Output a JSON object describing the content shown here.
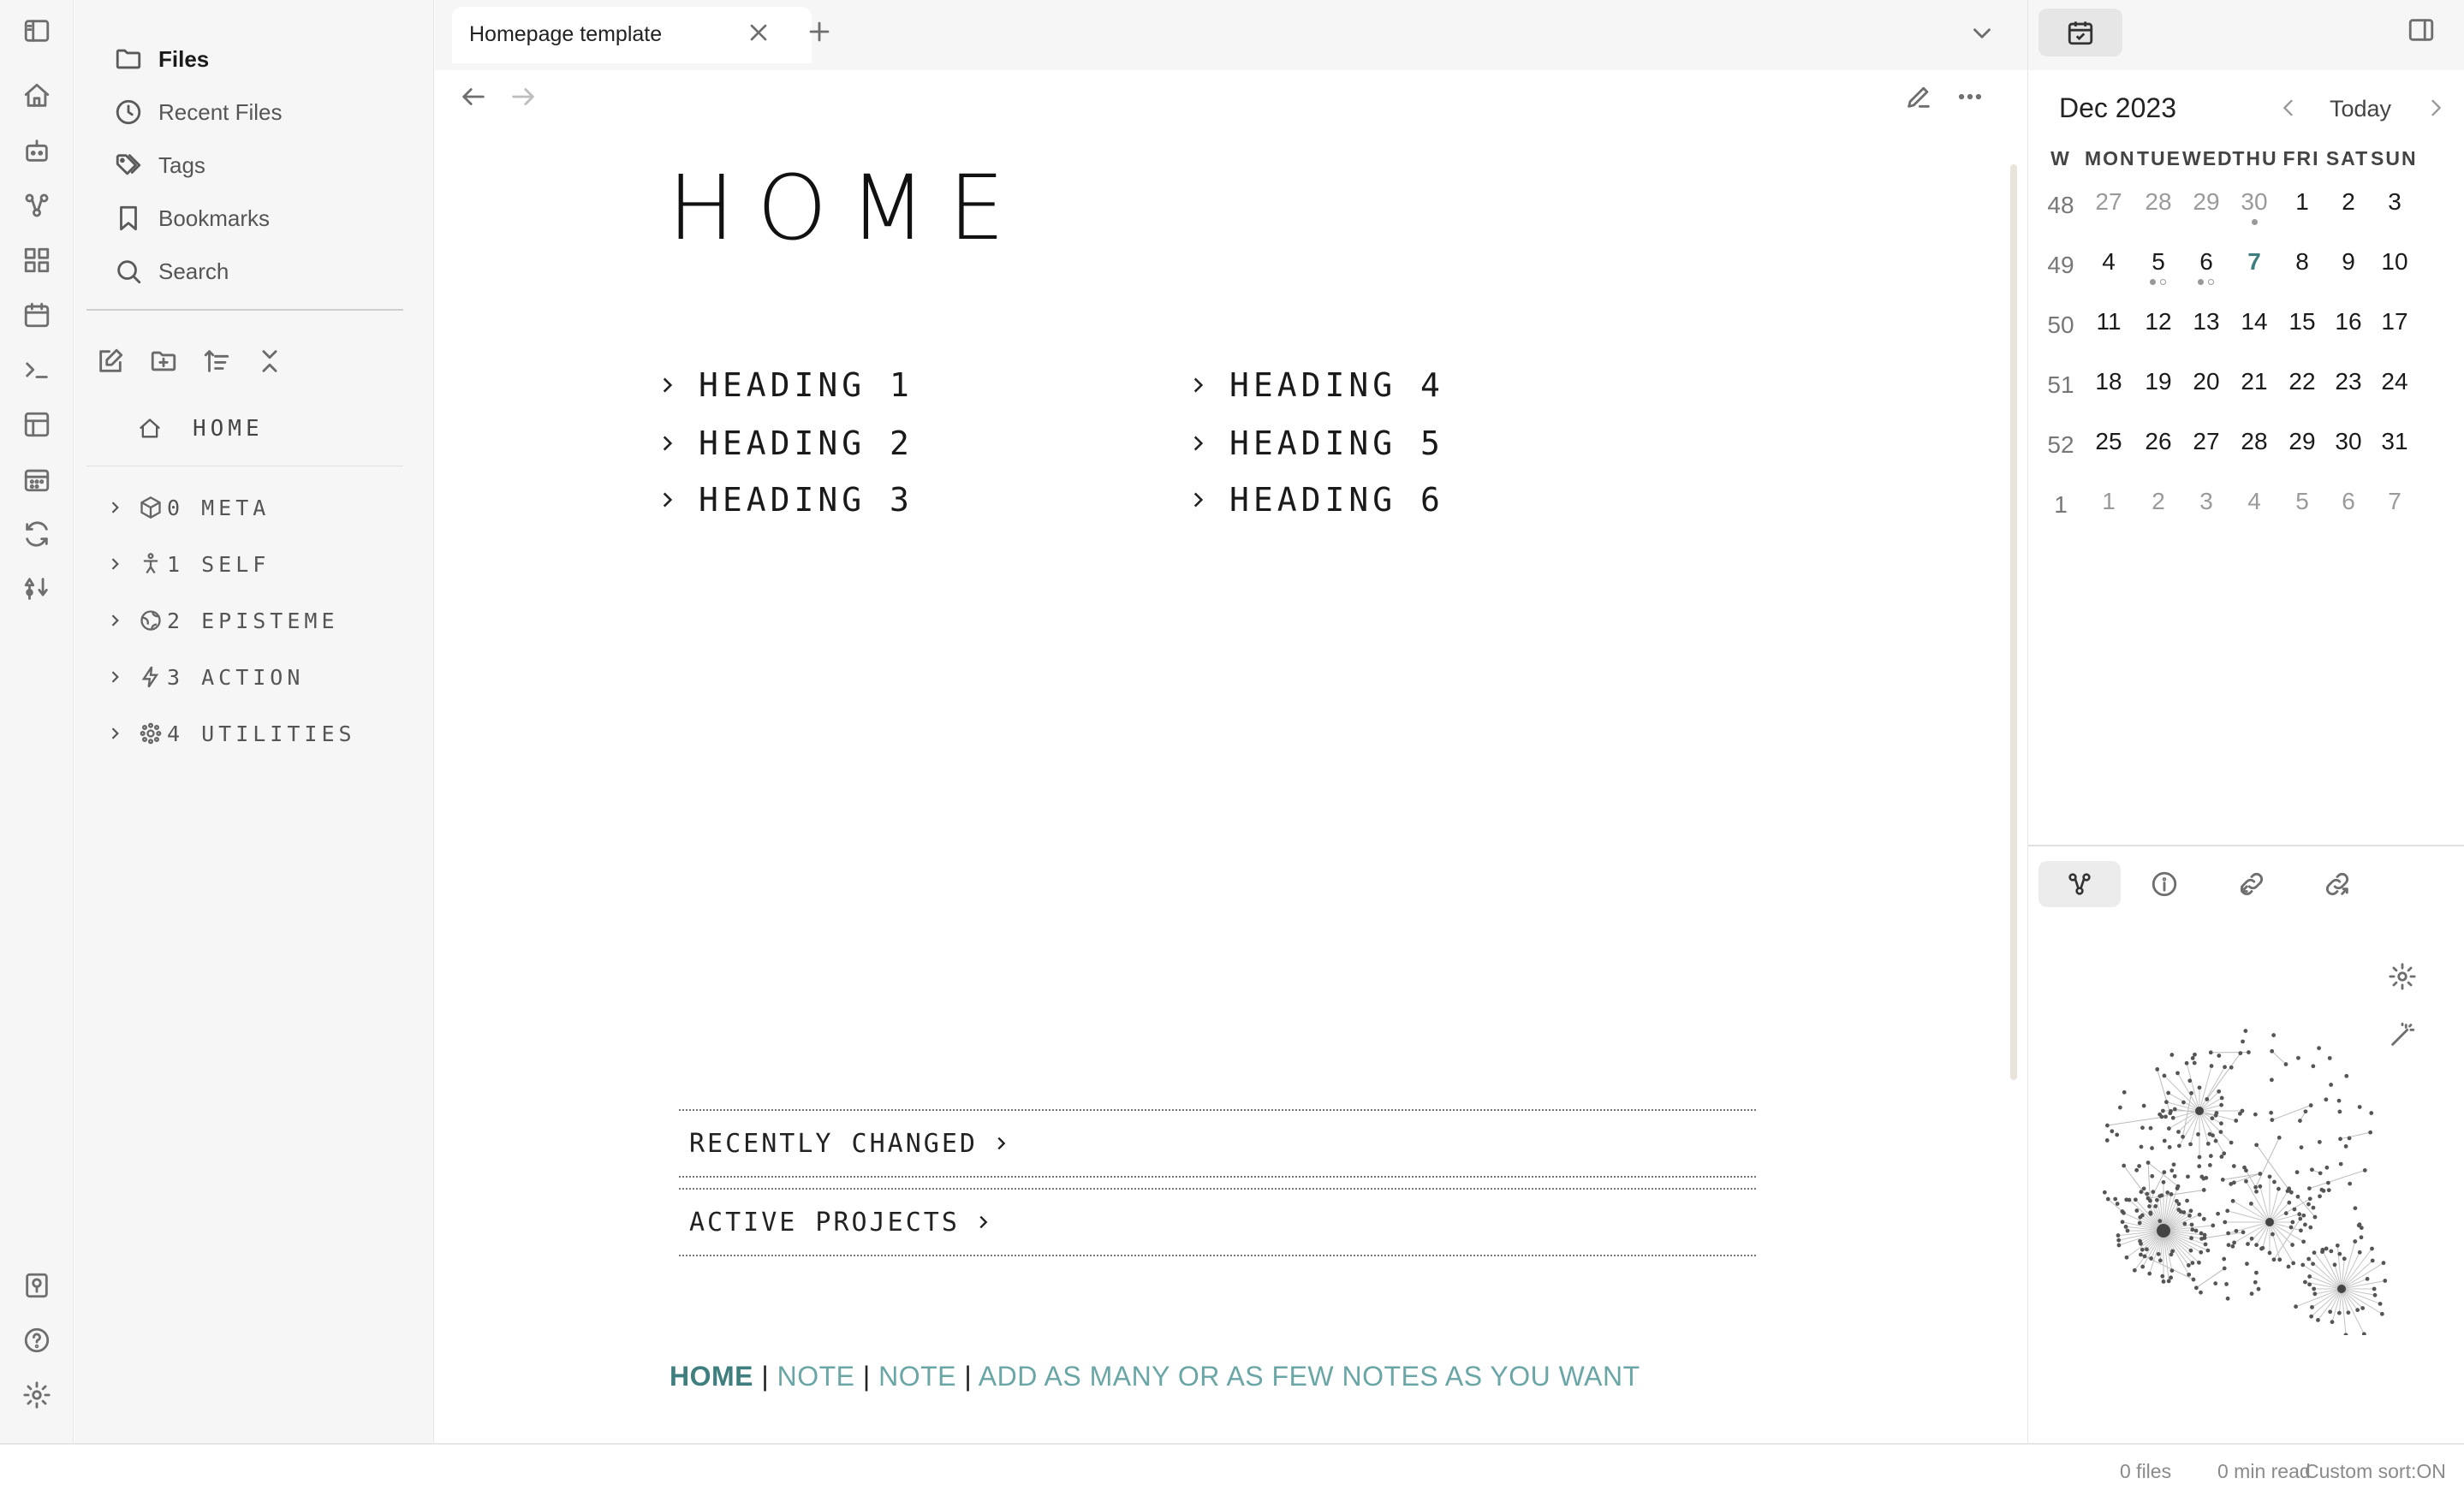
{
  "tab": {
    "title": "Homepage template"
  },
  "sidebar": {
    "nav": [
      {
        "label": "Files",
        "icon": "folder-icon",
        "active": true
      },
      {
        "label": "Recent Files",
        "icon": "clock-icon",
        "active": false
      },
      {
        "label": "Tags",
        "icon": "tags-icon",
        "active": false
      },
      {
        "label": "Bookmarks",
        "icon": "bookmark-icon",
        "active": false
      },
      {
        "label": "Search",
        "icon": "search-icon",
        "active": false
      }
    ],
    "home_note": "HOME",
    "folders": [
      {
        "label": "0 META",
        "icon": "cube-icon"
      },
      {
        "label": "1 SELF",
        "icon": "person-icon"
      },
      {
        "label": "2 EPISTEME",
        "icon": "globe-icon"
      },
      {
        "label": "3 ACTION",
        "icon": "bolt-icon"
      },
      {
        "label": "4 UTILITIES",
        "icon": "gear-dots-icon"
      }
    ]
  },
  "note": {
    "title": "HOME",
    "headings_left": [
      "HEADING 1",
      "HEADING 2",
      "HEADING 3"
    ],
    "headings_right": [
      "HEADING 4",
      "HEADING 5",
      "HEADING 6"
    ],
    "callouts": [
      "RECENTLY CHANGED",
      "ACTIVE PROJECTS"
    ],
    "footer": {
      "home": "HOME",
      "sep": "|",
      "note1": "NOTE",
      "note2": "NOTE",
      "extra": "ADD AS MANY OR AS FEW NOTES AS YOU WANT"
    }
  },
  "calendar": {
    "month": "Dec 2023",
    "today_label": "Today",
    "headers": [
      "W",
      "MON",
      "TUE",
      "WED",
      "THU",
      "FRI",
      "SAT",
      "SUN"
    ],
    "weeks": [
      {
        "week": "48",
        "days": [
          "27",
          "28",
          "29",
          "30",
          "1",
          "2",
          "3"
        ]
      },
      {
        "week": "49",
        "days": [
          "4",
          "5",
          "6",
          "7",
          "8",
          "9",
          "10"
        ]
      },
      {
        "week": "50",
        "days": [
          "11",
          "12",
          "13",
          "14",
          "15",
          "16",
          "17"
        ]
      },
      {
        "week": "51",
        "days": [
          "18",
          "19",
          "20",
          "21",
          "22",
          "23",
          "24"
        ]
      },
      {
        "week": "52",
        "days": [
          "25",
          "26",
          "27",
          "28",
          "29",
          "30",
          "31"
        ]
      },
      {
        "week": "1",
        "days": [
          "1",
          "2",
          "3",
          "4",
          "5",
          "6",
          "7"
        ]
      }
    ],
    "today": "7",
    "accent_color": "#3f7e7e"
  },
  "status": {
    "files": "0 files",
    "read": "0 min read",
    "sort": "Custom sort:ON"
  }
}
